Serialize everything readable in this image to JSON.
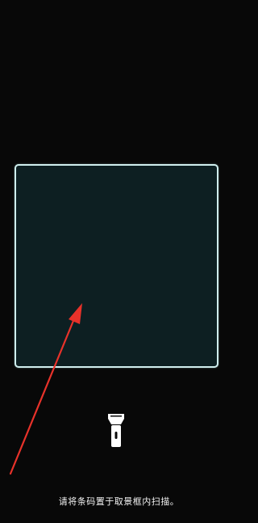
{
  "scanner": {
    "frame_color": "#cfeeee",
    "frame_fill": "#0d1f22",
    "hint_text": "请将条码置于取景框内扫描。"
  },
  "controls": {
    "flashlight_icon": "flashlight-icon",
    "flashlight_color": "#ffffff"
  },
  "annotation": {
    "arrow_color": "#e8322a"
  }
}
